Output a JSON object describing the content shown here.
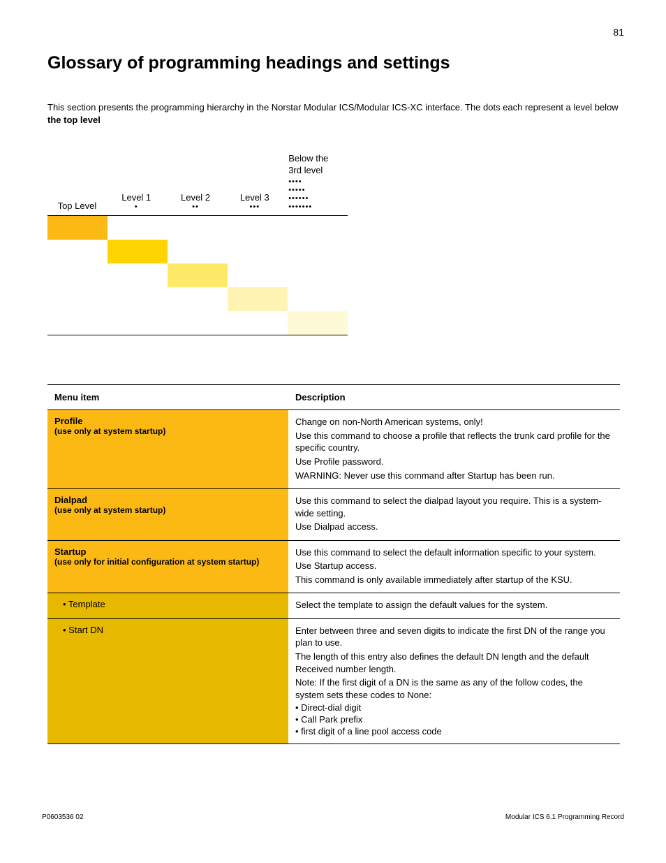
{
  "page_number": "81",
  "title": "Glossary of programming headings and settings",
  "intro_prefix": "This section presents the programming hierarchy in the Norstar Modular ICS/Modular ICS-XC interface. The dots each represent a level below ",
  "intro_bold": "the top level",
  "levels": {
    "top": {
      "label": "Top Level",
      "dots": ""
    },
    "l1": {
      "label": "Level 1",
      "dots": "•"
    },
    "l2": {
      "label": "Level 2",
      "dots": "••"
    },
    "l3": {
      "label": "Level 3",
      "dots": "•••"
    },
    "below": {
      "label_line1": "Below the",
      "label_line2": "3rd level",
      "dots1": "••••",
      "dots2": "•••••",
      "dots3": "••••••",
      "dots4": "•••••••"
    }
  },
  "table": {
    "header_menu": "Menu item",
    "header_desc": "Description",
    "rows": {
      "profile": {
        "title": "Profile",
        "note": "(use only at system startup)",
        "desc": [
          "Change on non-North American systems, only!",
          "Use this command to choose a profile that reflects the trunk card profile for the specific country.",
          "Use Profile password.",
          "WARNING: Never use this command after Startup has been run."
        ]
      },
      "dialpad": {
        "title": "Dialpad",
        "note": "(use only at system startup)",
        "desc": [
          "Use this command to select the dialpad layout you require. This is a system-wide setting.",
          "Use Dialpad access."
        ]
      },
      "startup": {
        "title": "Startup",
        "note": "(use only for initial configuration at system startup)",
        "desc": [
          "Use this command to select the default information specific to your system.",
          "Use Startup access.",
          "This command is only available immediately after startup of the KSU."
        ]
      },
      "template": {
        "title": "• Template",
        "desc": [
          "Select the template to assign the default values for the system."
        ]
      },
      "startdn": {
        "title": "• Start DN",
        "desc": [
          "Enter between three and seven digits to indicate the first DN of the range you plan to use.",
          "The length of this entry also defines the default DN length and the default Received number length.",
          "Note: If the first digit of a DN is the same as any of the follow codes, the system sets these codes to None:",
          "• Direct-dial digit",
          "• Call Park prefix",
          "• first digit of a line pool access code"
        ]
      }
    }
  },
  "footer_left": "P0603536  02",
  "footer_right": "Modular ICS 6.1 Programming Record"
}
